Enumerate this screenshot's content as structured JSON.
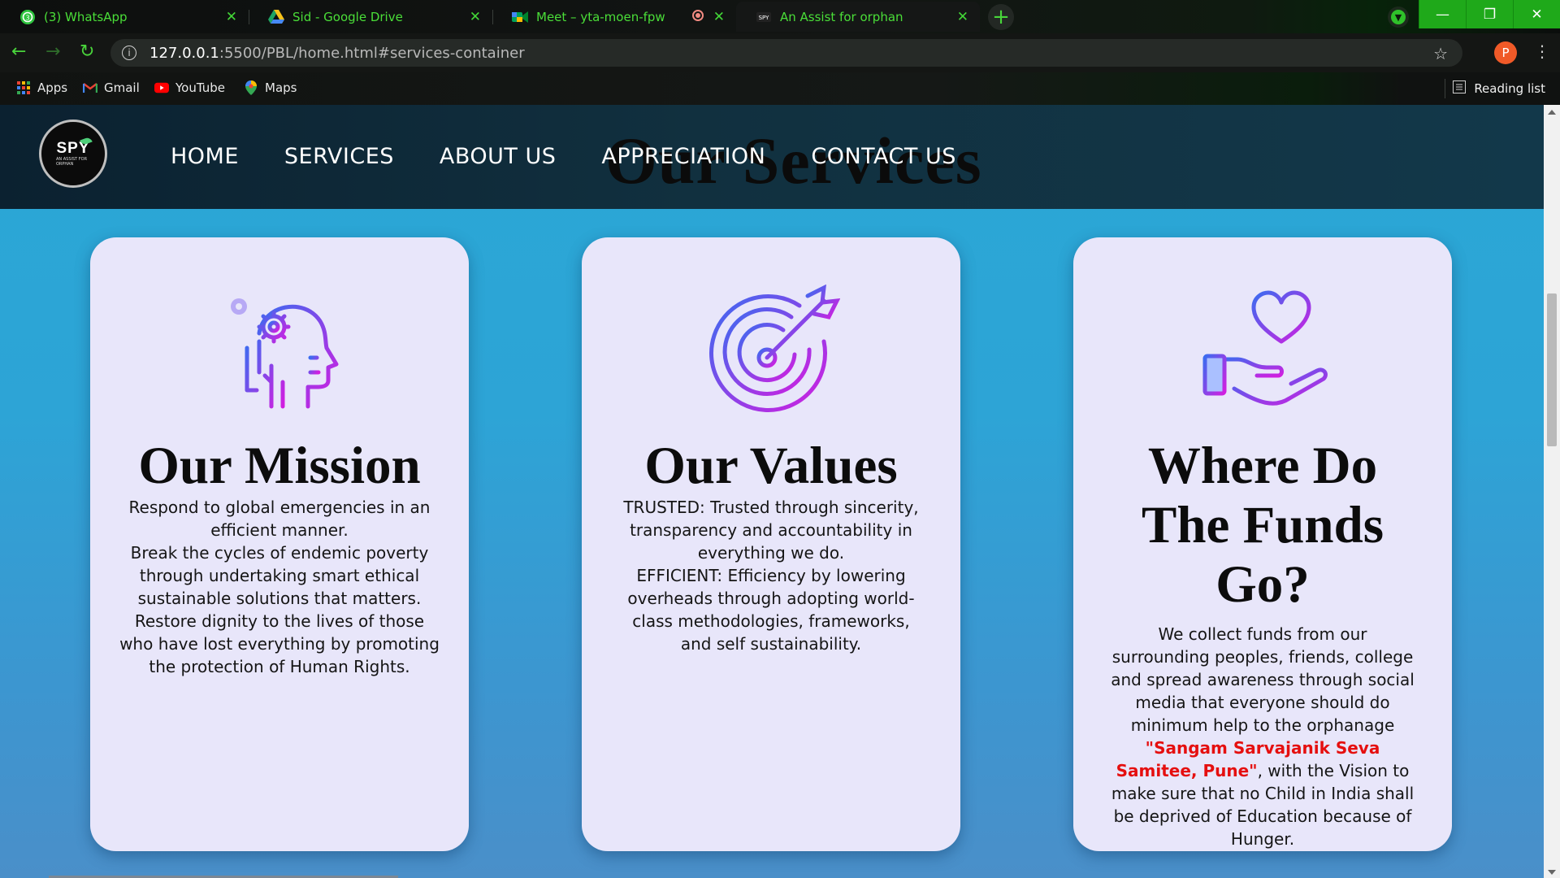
{
  "browser": {
    "tabs": [
      {
        "title": "(3) WhatsApp",
        "active": false
      },
      {
        "title": "Sid - Google Drive",
        "active": false
      },
      {
        "title": "Meet – yta-moen-fpw",
        "active": false
      },
      {
        "title": "An Assist for orphan",
        "active": true
      }
    ],
    "new_tab": "+",
    "window_buttons": {
      "minimize": "—",
      "restore": "❐",
      "close": "✕"
    },
    "url_host": "127.0.0.1",
    "url_rest": ":5500/PBL/home.html#services-container",
    "profile_letter": "P",
    "bookmarks": [
      "Apps",
      "Gmail",
      "YouTube",
      "Maps"
    ],
    "reading_list": "Reading list",
    "accent_color": "#4ade38"
  },
  "site": {
    "logo": {
      "name": "SPY",
      "tagline": "AN ASSIST FOR ORPHAN"
    },
    "section_heading": "Our Services",
    "nav": [
      "HOME",
      "SERVICES",
      "ABOUT US",
      "APPRECIATION",
      "CONTACT US"
    ],
    "cards": [
      {
        "icon": "head-gears-icon",
        "title": "Our Mission",
        "lines": [
          "Respond to global emergencies in an efficient manner.",
          "Break the cycles of endemic poverty through undertaking smart ethical sustainable solutions that matters.",
          "Restore dignity to the lives of those who have lost everything by promoting the protection of Human Rights."
        ]
      },
      {
        "icon": "target-arrow-icon",
        "title": "Our Values",
        "lines": [
          "TRUSTED: Trusted through sincerity, transparency and accountability in everything we do.",
          "EFFICIENT: Efficiency by lowering overheads through adopting world-class methodologies, frameworks, and self sustainability."
        ]
      },
      {
        "icon": "heart-hand-icon",
        "title": "Where Do The Funds Go?",
        "text_before": "We collect funds from our surrounding peoples, friends, college and spread awareness through social media that everyone should do minimum help to the orphanage ",
        "highlight": "\"Sangam Sarvajanik Seva Samitee, Pune\"",
        "text_after": ", with the Vision to make sure that no Child in India shall be deprived of Education because of Hunger."
      }
    ],
    "highlight_color": "#e50f0f"
  }
}
